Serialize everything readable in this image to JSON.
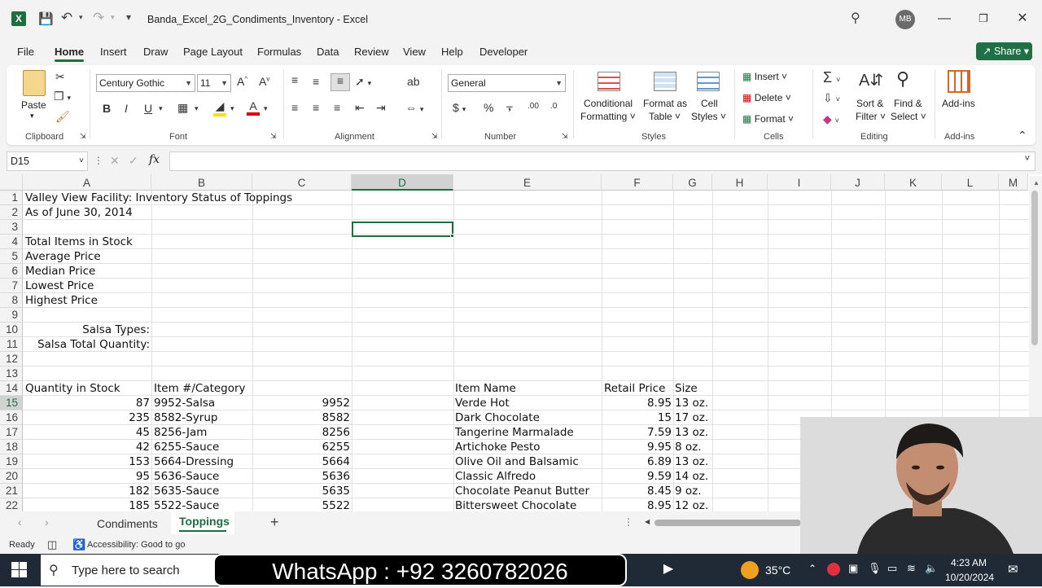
{
  "window": {
    "title": "Banda_Excel_2G_Condiments_Inventory  -  Excel",
    "user_initials": "MB"
  },
  "menu": {
    "items": [
      "File",
      "Home",
      "Insert",
      "Draw",
      "Page Layout",
      "Formulas",
      "Data",
      "Review",
      "View",
      "Help",
      "Developer"
    ],
    "share_label": "Share"
  },
  "ribbon": {
    "paste": "Paste",
    "clipboard": "Clipboard",
    "font_name": "Century Gothic",
    "font_size": "11",
    "font": "Font",
    "alignment": "Alignment",
    "number_format": "General",
    "number": "Number",
    "conditional_formatting_1": "Conditional",
    "conditional_formatting_2": "Formatting",
    "format_as_table_1": "Format as",
    "format_as_table_2": "Table",
    "cell_styles_1": "Cell",
    "cell_styles_2": "Styles",
    "styles": "Styles",
    "insert": "Insert",
    "delete": "Delete",
    "format": "Format",
    "cells": "Cells",
    "sort_filter_1": "Sort &",
    "sort_filter_2": "Filter",
    "find_select_1": "Find &",
    "find_select_2": "Select",
    "editing": "Editing",
    "addins": "Add-ins",
    "addins_group": "Add-ins"
  },
  "formula_bar": {
    "name_box": "D15",
    "fx": "fx",
    "content": ""
  },
  "columns": [
    "A",
    "B",
    "C",
    "D",
    "E",
    "F",
    "G",
    "H",
    "I",
    "J",
    "K",
    "L",
    "M"
  ],
  "rows": [
    "1",
    "2",
    "3",
    "4",
    "5",
    "6",
    "7",
    "8",
    "9",
    "10",
    "11",
    "12",
    "13",
    "14",
    "15",
    "16",
    "17",
    "18",
    "19",
    "20",
    "21",
    "22"
  ],
  "cells": {
    "A1": "Valley View Facility: Inventory Status of Toppings",
    "A2": "As of June 30, 2014",
    "A4": "Total Items in Stock",
    "A5": "Average Price",
    "A6": "Median Price",
    "A7": "Lowest Price",
    "A8": "Highest Price",
    "A10": "Salsa Types:",
    "A11": "Salsa Total Quantity:",
    "A14": "Quantity in Stock",
    "B14": "Item #/Category",
    "E14": "Item Name",
    "F14": "Retail Price",
    "G14": "Size"
  },
  "table_rows": [
    {
      "qty": "87",
      "item": "9952-Salsa",
      "num": "9952",
      "name": "Verde Hot",
      "price": "8.95",
      "size": "13 oz."
    },
    {
      "qty": "235",
      "item": "8582-Syrup",
      "num": "8582",
      "name": "Dark Chocolate",
      "price": "15",
      "size": "17 oz."
    },
    {
      "qty": "45",
      "item": "8256-Jam",
      "num": "8256",
      "name": "Tangerine Marmalade",
      "price": "7.59",
      "size": "13 oz."
    },
    {
      "qty": "42",
      "item": "6255-Sauce",
      "num": "6255",
      "name": "Artichoke Pesto",
      "price": "9.95",
      "size": "8 oz."
    },
    {
      "qty": "153",
      "item": "5664-Dressing",
      "num": "5664",
      "name": "Olive Oil and Balsamic",
      "price": "6.89",
      "size": "13 oz."
    },
    {
      "qty": "95",
      "item": "5636-Sauce",
      "num": "5636",
      "name": "Classic Alfredo",
      "price": "9.59",
      "size": "14 oz."
    },
    {
      "qty": "182",
      "item": "5635-Sauce",
      "num": "5635",
      "name": "Chocolate Peanut Butter",
      "price": "8.45",
      "size": "9 oz."
    },
    {
      "qty": "185",
      "item": "5522-Sauce",
      "num": "5522",
      "name": "Bittersweet Chocolate",
      "price": "8.95",
      "size": "12 oz."
    }
  ],
  "sheets": {
    "tab1": "Condiments",
    "tab2": "Toppings"
  },
  "status": {
    "ready": "Ready",
    "accessibility": "Accessibility: Good to go"
  },
  "taskbar": {
    "search_placeholder": "Type here to search",
    "overlay_text": "WhatsApp : +92 3260782026",
    "temperature": "35°C",
    "time": "4:23 AM",
    "date": "10/20/2024"
  }
}
